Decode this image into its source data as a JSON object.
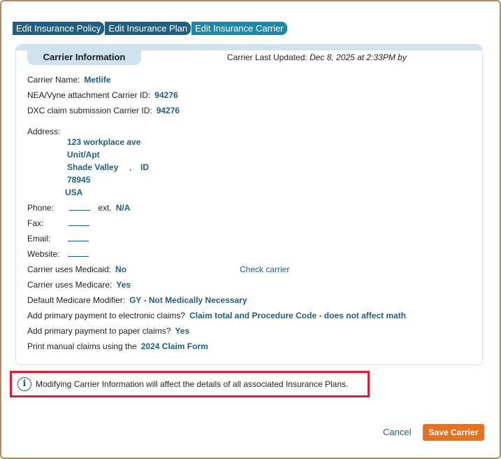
{
  "tabs": [
    {
      "label": "Edit Insurance Policy"
    },
    {
      "label": "Edit Insurance Plan"
    },
    {
      "label": "Edit Insurance Carrier"
    }
  ],
  "section": {
    "title": "Carrier Information",
    "last_updated_label": "Carrier Last Updated:",
    "last_updated_value": "Dec 8, 2025 at 2:33PM by"
  },
  "fields": {
    "carrier_name_label": "Carrier Name:",
    "carrier_name": "Metlife",
    "nea_label": "NEA/Vyne attachment Carrier ID:",
    "nea_id": "94276",
    "dxc_label": "DXC claim submission Carrier ID:",
    "dxc_id": "94276",
    "address_label": "Address:",
    "address_line1": "123 workplace ave",
    "address_line2": "Unit/Apt",
    "city": "Shade Valley",
    "city_sep": ",",
    "state": "ID",
    "zip": "78945",
    "country": "USA",
    "phone_label": "Phone:",
    "ext_label": "ext.",
    "ext_value": "N/A",
    "fax_label": "Fax:",
    "email_label": "Email:",
    "website_label": "Website:",
    "medicaid_label": "Carrier uses Medicaid:",
    "medicaid_value": "No",
    "check_carrier": "Check carrier",
    "medicare_label": "Carrier uses Medicare:",
    "medicare_value": "Yes",
    "modifier_label": "Default Medicare Modifier:",
    "modifier_value": "GY - Not Medically Necessary",
    "electronic_label": "Add primary payment to electronic claims?",
    "electronic_value": "Claim total and Procedure Code - does not affect math",
    "paper_label": "Add primary payment to paper claims?",
    "paper_value": "Yes",
    "print_label": "Print manual claims using the",
    "print_value": "2024 Claim Form"
  },
  "notice": {
    "text": "Modifying Carrier Information will affect the details of all associated Insurance Plans.",
    "icon": "info-icon"
  },
  "footer": {
    "cancel": "Cancel",
    "save": "Save Carrier"
  },
  "colors": {
    "tab": "#1f5f80",
    "tab_active": "#1c88aa",
    "value_text": "#1f5f80",
    "save_button": "#e5731d",
    "notice_border": "#e31b2d"
  }
}
